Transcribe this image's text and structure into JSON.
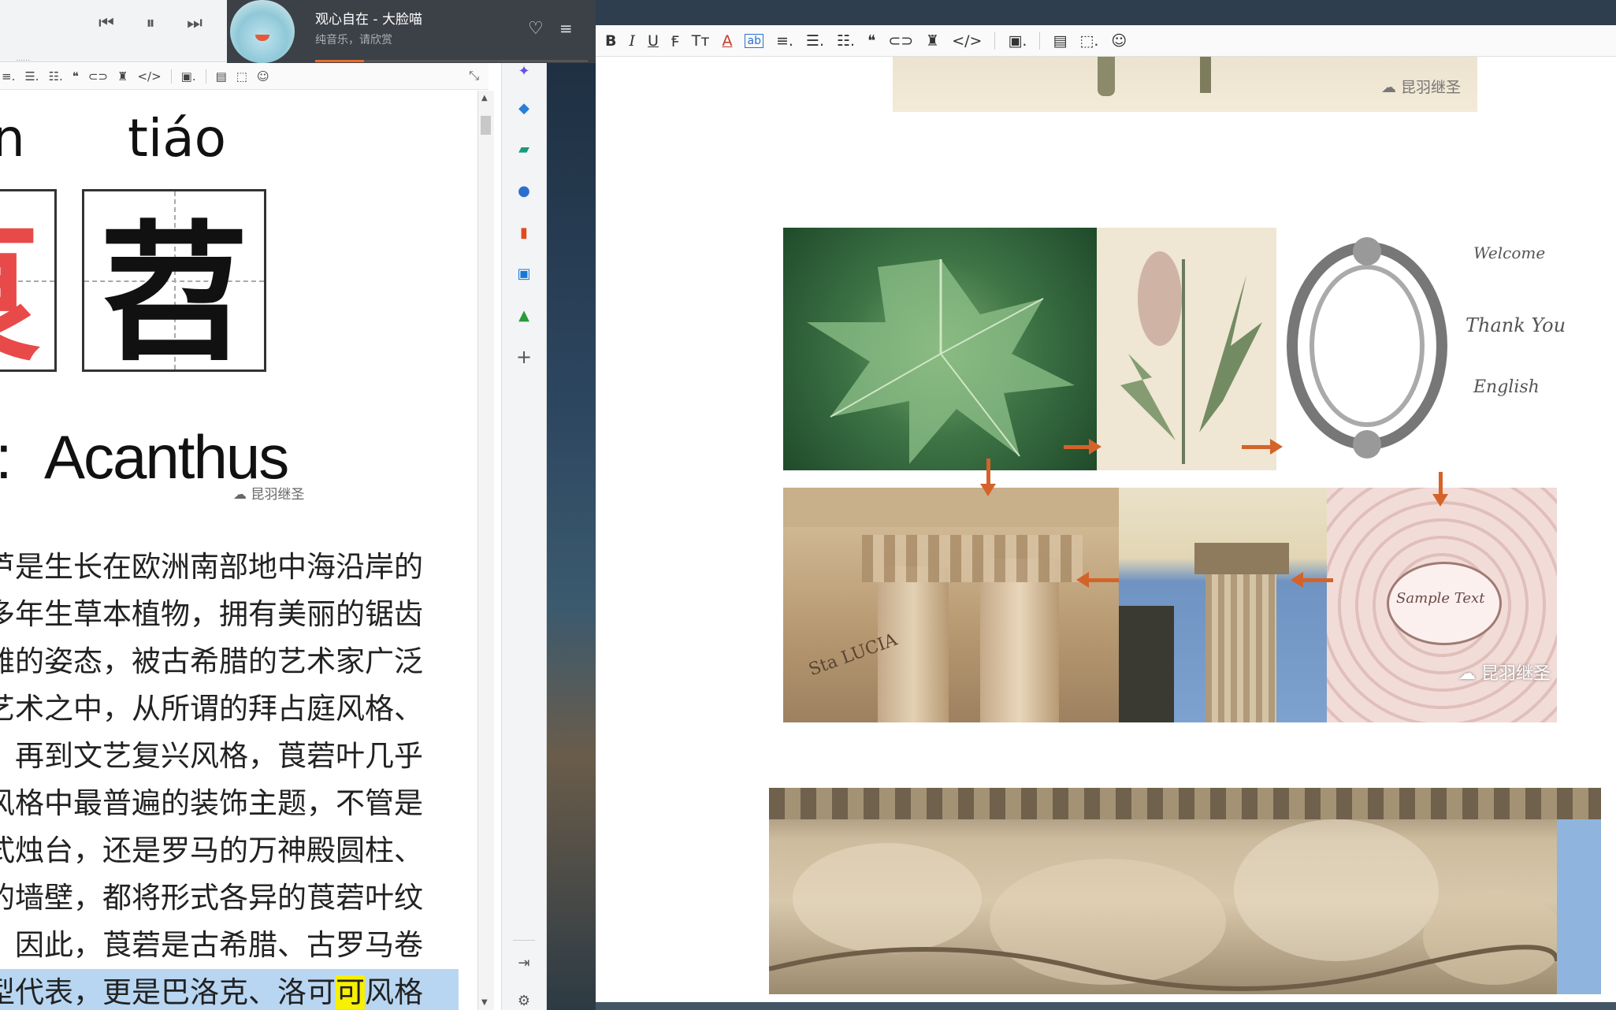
{
  "left_editor": {
    "faint_header": "……",
    "toolbar": {
      "items": [
        "≡.",
        "☰.",
        "☷.",
        "❝",
        "⊂⊃",
        "♜",
        "</>",
        "▣.",
        "▤",
        "⬚",
        "☺"
      ],
      "collapse": "⤡"
    },
    "pinyin_left": "n",
    "pinyin_right": "tiáo",
    "hanzi_left": "茛",
    "hanzi_right": "苕",
    "latin_word": "Acanthus",
    "latin_prefix": ":",
    "watermark": "昆羽继圣",
    "article_lines": [
      "芦是生长在欧洲南部地中海沿岸的",
      "多年生草本植物，拥有美丽的锯齿",
      "雅的姿态，被古希腊的艺术家广泛",
      "艺术之中，从所谓的拜占庭风格、",
      "，再到文艺复兴风格，莨菪叶几乎",
      "风格中最普遍的装饰主题，不管是",
      "式烛台，还是罗马的万神殿圆柱、",
      "的墙壁，都将形式各异的莨菪叶纹",
      "，因此，莨菪是古希腊、古罗马卷"
    ],
    "article_last_line": {
      "before": "型代表，更是巴洛克、洛可",
      "highlight": "可",
      "after": "风格"
    }
  },
  "player": {
    "controls": [
      "⏮",
      "⏸",
      "⏭"
    ],
    "title": "观心自在 - 大脸喵",
    "subtitle": "纯音乐，请欣赏",
    "heart": "♡",
    "playlist": "≡",
    "progress": 0.18
  },
  "sidebar": {
    "icons": [
      {
        "name": "sparkle-icon",
        "glyph": "✦",
        "color": "#6a4ee0"
      },
      {
        "name": "tag-icon",
        "glyph": "◆",
        "color": "#2a7fd8"
      },
      {
        "name": "toolbox-icon",
        "glyph": "▰",
        "color": "#1a9a7a"
      },
      {
        "name": "people-icon",
        "glyph": "●",
        "color": "#2a6fd0"
      },
      {
        "name": "office-icon",
        "glyph": "▮",
        "color": "#e04a1e"
      },
      {
        "name": "outlook-icon",
        "glyph": "▣",
        "color": "#1478d4"
      },
      {
        "name": "tree-icon",
        "glyph": "▲",
        "color": "#2a9a3a"
      },
      {
        "name": "add-icon",
        "glyph": "+",
        "color": "#555555"
      }
    ],
    "bottom_icons": [
      {
        "name": "exit-panel-icon",
        "glyph": "⇥",
        "color": "#555555"
      },
      {
        "name": "settings-icon",
        "glyph": "⚙",
        "color": "#555555"
      }
    ]
  },
  "right_editor": {
    "toolbar": [
      "B",
      "I",
      "U",
      "Ꞙ",
      "Tт",
      "A",
      "ab",
      "≡.",
      "☰.",
      "☷.",
      "❝",
      "⊂⊃",
      "♜",
      "</>",
      "▣.",
      "▤",
      "⬚.",
      "☺"
    ],
    "watermark": "昆羽继圣",
    "top_image_caption": "昆羽继圣",
    "engraving_text_1": "Welcome",
    "engraving_text_2": "Thank You",
    "engraving_text_3": "English",
    "engraving_text_4": "Sample Text",
    "column_inscription": "Sta LUCIA"
  }
}
